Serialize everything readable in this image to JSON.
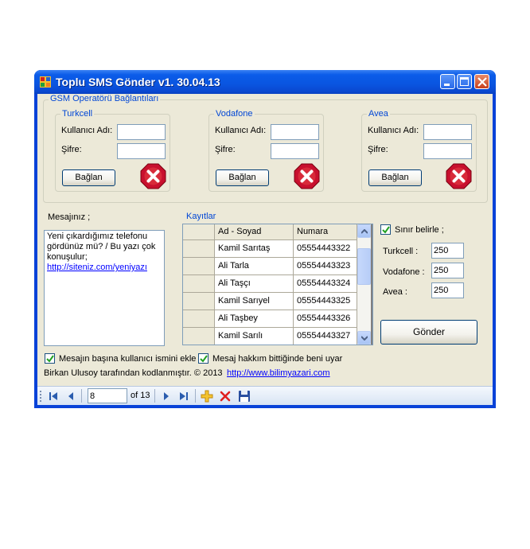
{
  "window": {
    "title": "Toplu SMS Gönder v1. 30.04.13"
  },
  "operators_group": {
    "title": "GSM Operatörü Bağlantıları",
    "operators": [
      {
        "name": "Turkcell",
        "username_label": "Kullanıcı Adı:",
        "username_value": "",
        "password_label": "Şifre:",
        "password_value": "",
        "connect_label": "Bağlan",
        "status_icon": "error-x-icon"
      },
      {
        "name": "Vodafone",
        "username_label": "Kullanıcı Adı:",
        "username_value": "",
        "password_label": "Şifre:",
        "password_value": "",
        "connect_label": "Bağlan",
        "status_icon": "error-x-icon"
      },
      {
        "name": "Avea",
        "username_label": "Kullanıcı Adı:",
        "username_value": "",
        "password_label": "Şifre:",
        "password_value": "",
        "connect_label": "Bağlan",
        "status_icon": "error-x-icon"
      }
    ]
  },
  "message": {
    "label": "Mesajınız ;",
    "text": "Yeni çıkardığımız telefonu gördünüz mü? / Bu yazı çok konuşulur;",
    "link": "http://siteniz.com/yeniyazı"
  },
  "records": {
    "title": "Kayıtlar",
    "columns": [
      "Ad - Soyad",
      "Numara"
    ],
    "rows": [
      {
        "name": "Kamil Sarıtaş",
        "number": "05554443322"
      },
      {
        "name": "Ali Tarla",
        "number": "05554443323"
      },
      {
        "name": "Ali Taşçı",
        "number": "05554443324"
      },
      {
        "name": "Kamil Sarıyel",
        "number": "05554443325"
      },
      {
        "name": "Ali Taşbey",
        "number": "05554443326"
      },
      {
        "name": "Kamil Sarılı",
        "number": "05554443327"
      }
    ]
  },
  "limits": {
    "checkbox_label": "Sınır belirle ;",
    "checked": true,
    "items": [
      {
        "label": "Turkcell :",
        "value": "250"
      },
      {
        "label": "Vodafone :",
        "value": "250"
      },
      {
        "label": "Avea :",
        "value": "250"
      }
    ],
    "send_label": "Gönder"
  },
  "options": {
    "prepend_name_label": "Mesajın başına kullanıcı ismini ekle",
    "prepend_name_checked": true,
    "warn_label": "Mesaj hakkım bittiğinde beni uyar",
    "warn_checked": true
  },
  "footer": {
    "credit": "Birkan Ulusoy tarafından kodlanmıştır. © 2013",
    "link": "http://www.bilimyazari.com"
  },
  "navigator": {
    "position": "8",
    "count": "of 13"
  },
  "colors": {
    "titlebar": "#0a55e0",
    "client": "#ece9d8",
    "group_title": "#0046d5",
    "link": "#0000ff",
    "error_icon": "#c8102e"
  }
}
